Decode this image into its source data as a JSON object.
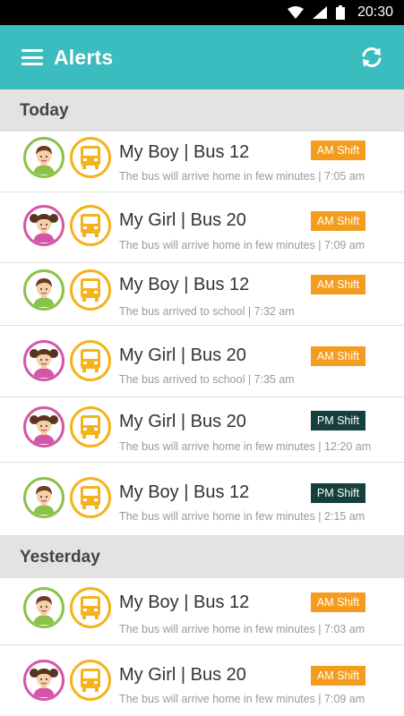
{
  "status_bar": {
    "time": "20:30",
    "wifi_icon": "wifi-icon",
    "signal_icon": "signal-icon",
    "battery_icon": "battery-icon"
  },
  "app_bar": {
    "title": "Alerts",
    "menu_icon": "menu-icon",
    "refresh_icon": "refresh-icon",
    "color": "#3bbcbf"
  },
  "colors": {
    "am_shift": "#f39c1e",
    "pm_shift": "#16403d",
    "boy_ring": "#8bc34a",
    "girl_ring": "#d556a8",
    "bus_ring": "#f5b21b"
  },
  "sections": [
    {
      "label": "Today",
      "alerts": [
        {
          "child": "boy",
          "title": "My Boy | Bus 12",
          "message": "The bus will arrive home in few minutes | 7:05 am",
          "shift": "AM Shift"
        },
        {
          "child": "girl",
          "title": "My Girl | Bus 20",
          "message": "The bus will arrive home in few minutes | 7:09 am",
          "shift": "AM Shift"
        },
        {
          "child": "boy",
          "title": "My Boy | Bus 12",
          "message": "The bus arrived to school | 7:32 am",
          "shift": "AM Shift"
        },
        {
          "child": "girl",
          "title": "My Girl | Bus 20",
          "message": "The bus arrived to school | 7:35 am",
          "shift": "AM Shift"
        },
        {
          "child": "girl",
          "title": "My Girl | Bus 20",
          "message": "The bus will arrive home in few minutes | 12:20 am",
          "shift": "PM Shift"
        },
        {
          "child": "boy",
          "title": "My Boy | Bus 12",
          "message": "The bus will arrive home in few minutes | 2:15 am",
          "shift": "PM Shift"
        }
      ]
    },
    {
      "label": "Yesterday",
      "alerts": [
        {
          "child": "boy",
          "title": "My Boy | Bus 12",
          "message": "The bus will arrive home in few minutes | 7:03 am",
          "shift": "AM Shift"
        },
        {
          "child": "girl",
          "title": "My Girl | Bus 20",
          "message": "The bus will arrive home in few minutes | 7:09 am",
          "shift": "AM Shift"
        }
      ]
    }
  ]
}
